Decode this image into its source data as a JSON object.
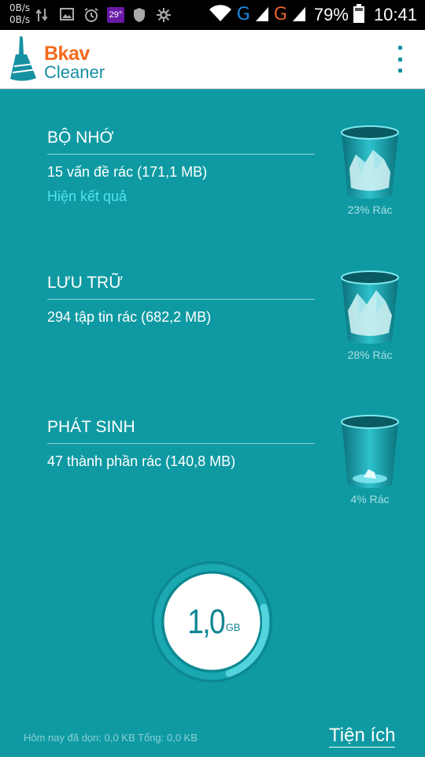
{
  "status_bar": {
    "upload_speed": "0B/s",
    "download_speed": "0B/s",
    "temperature": "29°",
    "network_1": "G",
    "network_2": "G",
    "battery": "79%",
    "time": "10:41"
  },
  "app_bar": {
    "logo_brand": "Bkav",
    "logo_product": "Cleaner",
    "menu_icon": "overflow-menu-icon"
  },
  "sections": [
    {
      "title": "BỘ NHỚ",
      "description": "15 vấn đề rác (171,1 MB)",
      "link": "Hiện kết quả",
      "bin_label": "23% Rác",
      "fill": 0.23
    },
    {
      "title": "LƯU TRỮ",
      "description": "294 tập tin rác (682,2 MB)",
      "bin_label": "28% Rác",
      "fill": 0.28
    },
    {
      "title": "PHÁT SINH",
      "description": "47 thành phần rác (140,8 MB)",
      "bin_label": "4% Rác",
      "fill": 0.04
    }
  ],
  "meter": {
    "value": "1,0",
    "unit": "GB"
  },
  "footer": {
    "info": "Hôm nay đã dọn: 0,0 KB Tổng: 0,0 KB",
    "utility_button": "Tiện ích"
  },
  "colors": {
    "background": "#0f9aa3",
    "accent_orange": "#f26a1b",
    "link_cyan": "#4fe3ee",
    "network_g_blue": "#1e88e5",
    "network_g_orange": "#e8612c"
  }
}
